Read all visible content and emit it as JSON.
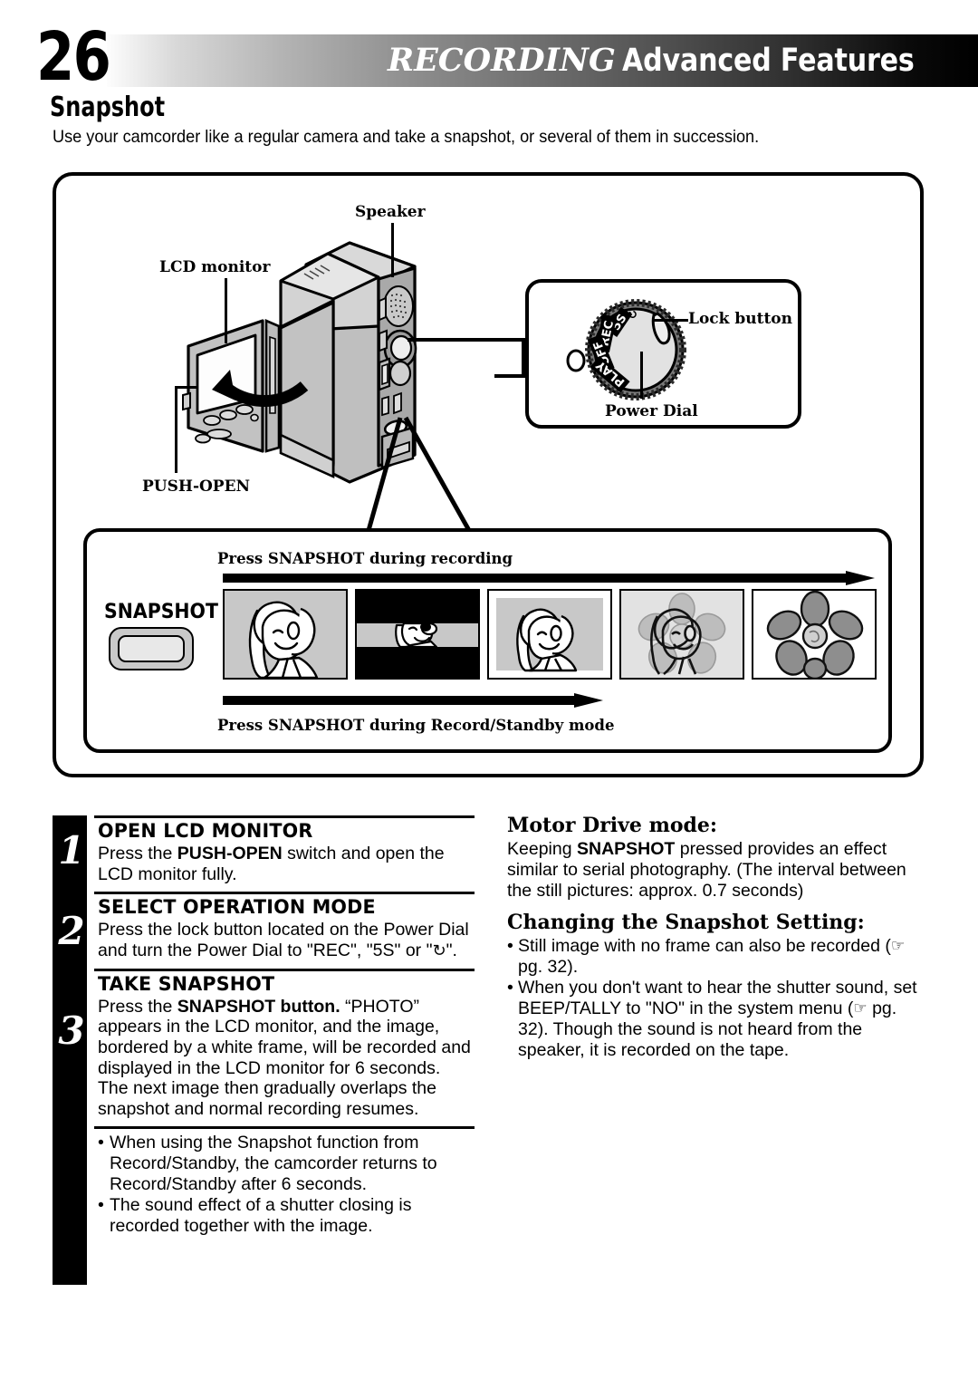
{
  "header": {
    "page_number": "26",
    "title_italic": "RECORDING",
    "title_bold": "Advanced Features"
  },
  "section": {
    "title": "Snapshot",
    "intro": "Use your camcorder like a regular camera and take a snapshot, or several of them in succession."
  },
  "diagram": {
    "labels": {
      "speaker": "Speaker",
      "lcd_monitor": "LCD monitor",
      "push_open": "PUSH-OPEN",
      "lock_button": "Lock button",
      "power_dial": "Power Dial"
    },
    "dial_positions": [
      "REC",
      "5S",
      "OFF",
      "PLAY"
    ],
    "dial_timer_icon": "self-timer-icon"
  },
  "sequence": {
    "top_caption": "Press SNAPSHOT during recording",
    "bottom_caption": "Press SNAPSHOT during Record/Standby mode",
    "snapshot_label": "SNAPSHOT",
    "frames": [
      {
        "name": "live-image-woman"
      },
      {
        "name": "shutter-closing-bands"
      },
      {
        "name": "snapshot-white-frame-woman"
      },
      {
        "name": "dissolve-overlap-woman-flower"
      },
      {
        "name": "live-image-flower"
      }
    ]
  },
  "steps": [
    {
      "number": "1",
      "heading": "OPEN LCD MONITOR",
      "body_pre": "Press the ",
      "body_bold": "PUSH-OPEN",
      "body_post": " switch and open the LCD monitor fully."
    },
    {
      "number": "2",
      "heading": "SELECT OPERATION MODE",
      "body_pre": "Press the lock button located on the Power Dial and turn the Power Dial to \"REC\", \"5S\" or \"",
      "body_bold": "",
      "body_post": "\"."
    },
    {
      "number": "3",
      "heading": "TAKE SNAPSHOT",
      "body_pre": "Press the ",
      "body_bold": "SNAPSHOT button.",
      "body_post": " “PHOTO” appears in the LCD monitor, and the image, bordered by a white frame, will be recorded and displayed in the LCD monitor for 6 seconds. The next image then gradually overlaps the snapshot and normal recording resumes."
    }
  ],
  "left_notes": [
    "When using the Snapshot function from Record/Standby, the camcorder returns to Record/Standby after 6 seconds.",
    "The sound effect of a shutter closing is recorded together with the image."
  ],
  "right": {
    "motor_head": "Motor Drive mode:",
    "motor_body_pre": "Keeping ",
    "motor_body_bold": "SNAPSHOT",
    "motor_body_post": " pressed provides an effect similar to serial photography. (The interval between the still pictures: approx. 0.7 seconds)",
    "setting_head": "Changing the Snapshot Setting:",
    "note1_pre": "Still image with no frame can also be recorded (",
    "note1_ref": " pg. 32).",
    "note2_pre": "When you don't want to hear the shutter sound, set BEEP/TALLY to \"NO\" in the system menu (",
    "note2_ref": " pg. 32). Though the sound is not heard from the speaker, it is recorded on the tape."
  },
  "colors": {
    "ink": "#000000",
    "paper": "#ffffff",
    "body_grey": "#c0c0c0",
    "body_light": "#dcdcdc",
    "frame_grey": "#c8c8c8"
  }
}
